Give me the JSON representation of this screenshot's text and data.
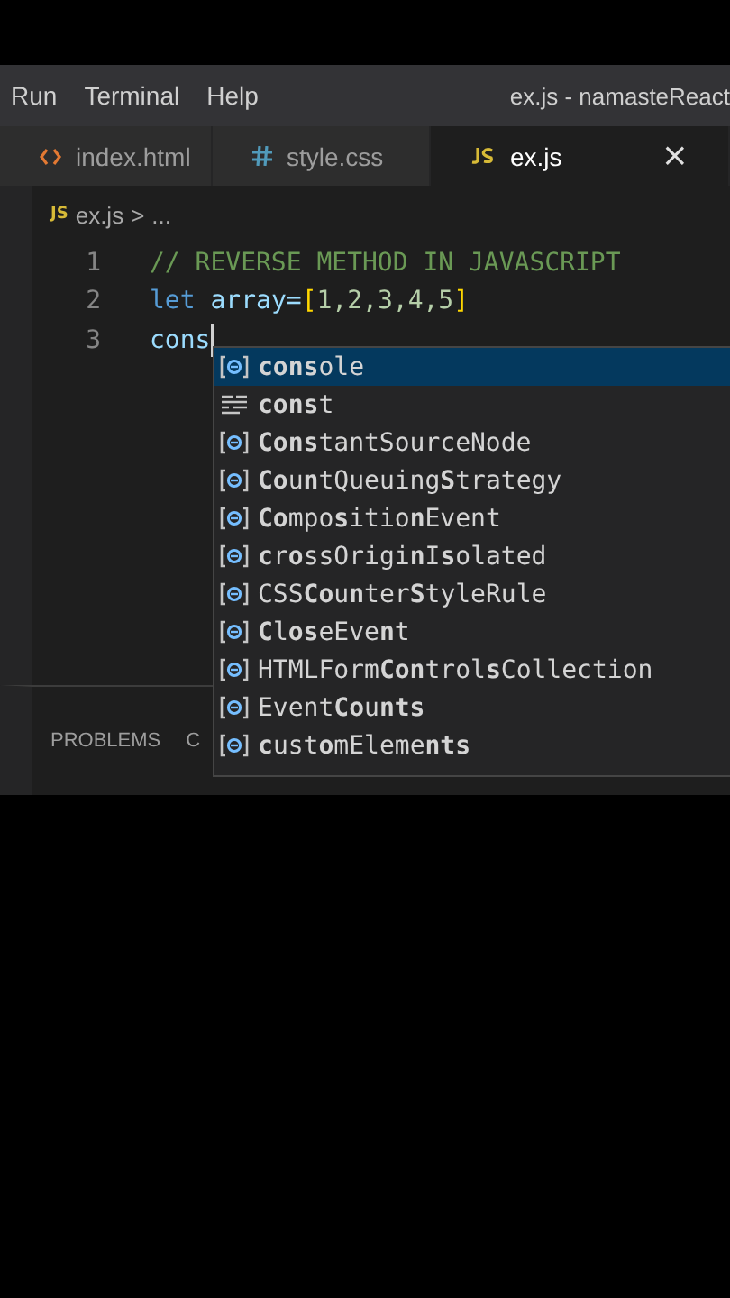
{
  "menu_bar": {
    "items": [
      "Run",
      "Terminal",
      "Help"
    ],
    "title": "ex.js - namasteReact"
  },
  "tabs": [
    {
      "label": "index.html",
      "kind": "html",
      "selected": false
    },
    {
      "label": "style.css",
      "kind": "css",
      "selected": false
    },
    {
      "label": "ex.js",
      "kind": "js",
      "selected": true,
      "close": "×"
    }
  ],
  "breadcrumb": {
    "icon": "JS",
    "file": "ex.js",
    "separator": ">",
    "rest": "..."
  },
  "code_lines": [
    {
      "number": "1",
      "kind": "comment",
      "text": "// REVERSE METHOD IN JAVASCRIPT"
    },
    {
      "number": "2",
      "kind": "declaration",
      "keyword": "let",
      "name": "array=",
      "bracket_open": "[",
      "values": "1,2,3,4,5",
      "bracket_close": "]"
    },
    {
      "number": "3",
      "kind": "typing",
      "text": "cons"
    }
  ],
  "suggestions": [
    {
      "label": "**cons**ole",
      "kind": "variable",
      "selected": true
    },
    {
      "label": "**cons**t",
      "kind": "keyword",
      "selected": false
    },
    {
      "label": "**Cons**tantSourceNode",
      "kind": "variable",
      "selected": false
    },
    {
      "label": "**Co**u**n**tQueuing**S**trategy",
      "kind": "variable",
      "selected": false
    },
    {
      "label": "**Co**mpo**s**itio**n**Event",
      "kind": "variable",
      "selected": false
    },
    {
      "label": "**c**r**o**ssOrigi**n**I**s**olated",
      "kind": "variable",
      "selected": false
    },
    {
      "label": "CSS**Co**u**n**ter**S**tyleRule",
      "kind": "variable",
      "selected": false
    },
    {
      "label": "**C**l**os**eEve**n**t",
      "kind": "variable",
      "selected": false
    },
    {
      "label": "HTMLForm**Con**trol**s**Collection",
      "kind": "variable",
      "selected": false
    },
    {
      "label": "Event**Co**u**nts**",
      "kind": "variable",
      "selected": false
    },
    {
      "label": "**c**ust**o**mEleme**nts**",
      "kind": "variable",
      "selected": false
    }
  ],
  "panel": {
    "tabs": [
      {
        "label": "PROBLEMS",
        "selected": false
      },
      {
        "label": "C",
        "selected": false
      }
    ]
  }
}
